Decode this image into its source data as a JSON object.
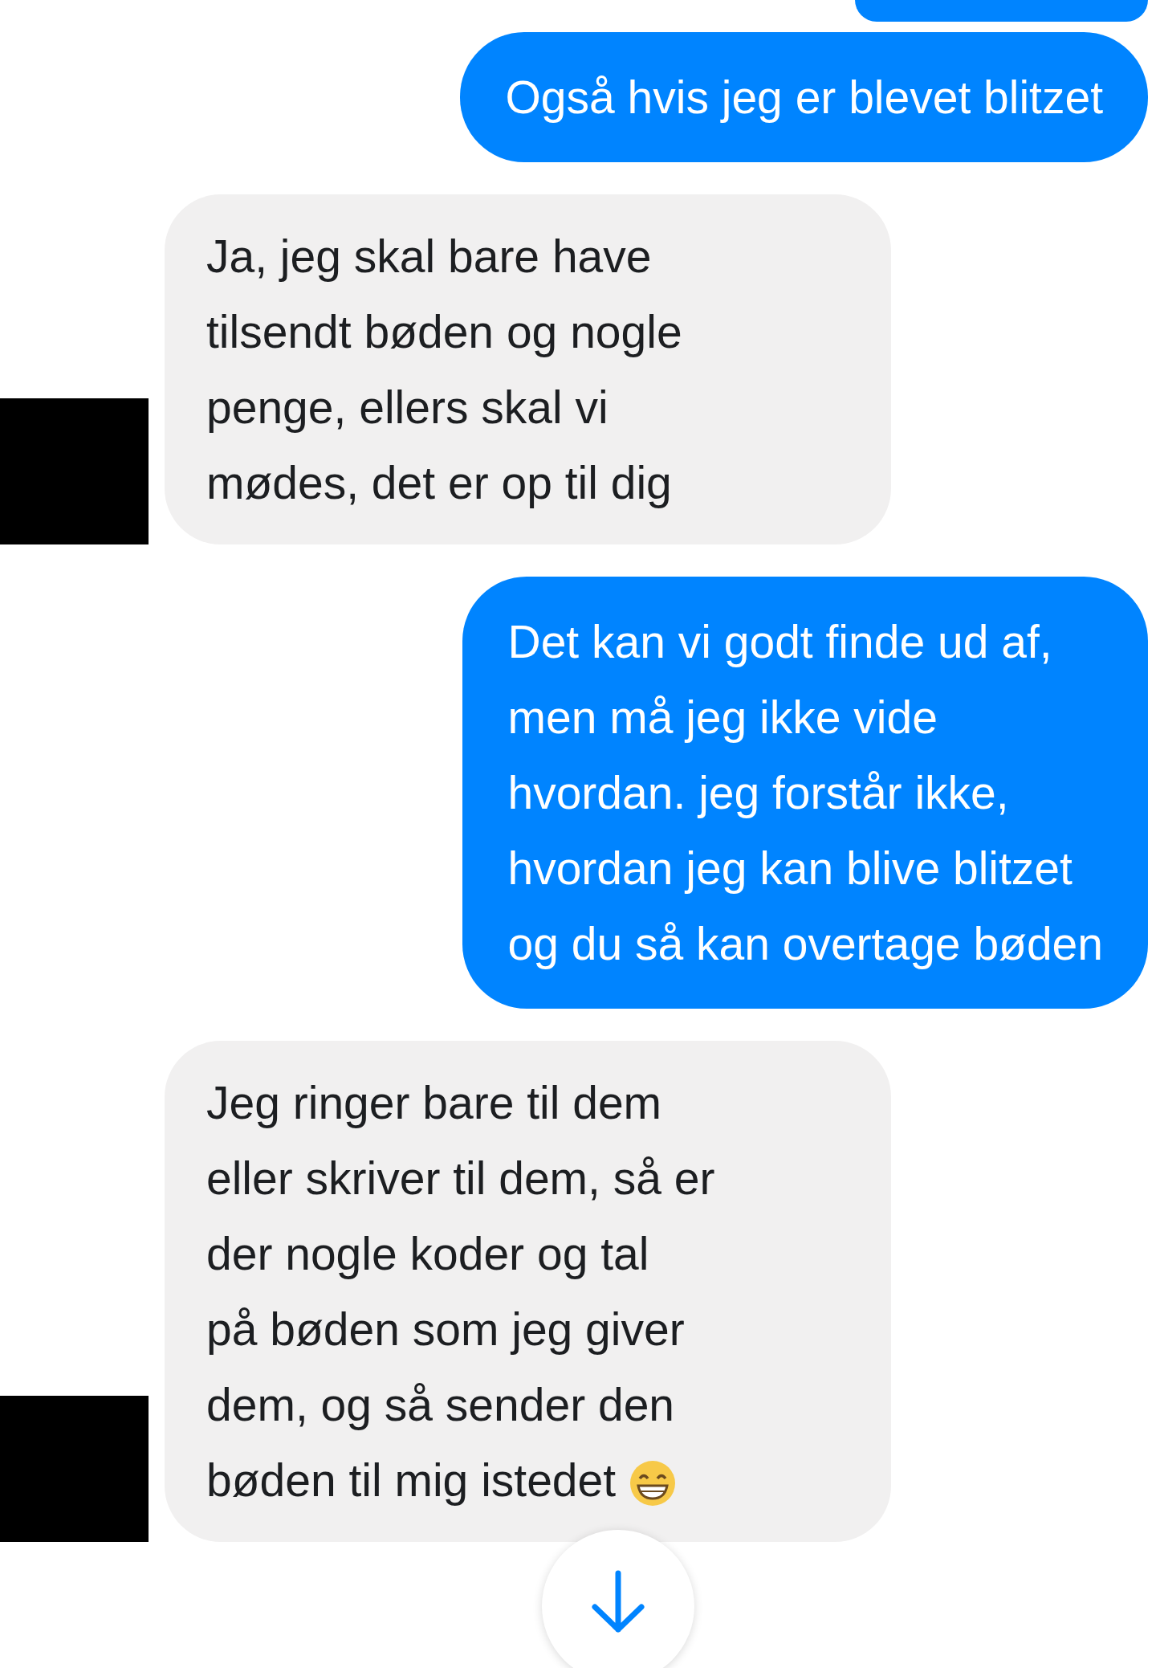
{
  "messages": [
    {
      "kind": "sent",
      "lines": [
        "Også hvis jeg er blevet blitzet"
      ],
      "emoji": false
    },
    {
      "kind": "received",
      "lines": [
        "Ja, jeg skal bare have",
        "tilsendt bøden og nogle",
        "penge, ellers skal vi",
        "mødes, det er op til dig"
      ],
      "emoji": false
    },
    {
      "kind": "sent",
      "lines": [
        "Det kan vi godt finde ud af,",
        "men må jeg ikke vide",
        "hvordan. jeg forstår ikke,",
        "hvordan jeg kan blive blitzet",
        "og du så kan overtage bøden"
      ],
      "emoji": false
    },
    {
      "kind": "received",
      "lines": [
        "Jeg ringer bare til dem",
        "eller skriver til dem, så er",
        "der nogle koder og tal",
        "på bøden som jeg giver",
        "dem, og så sender den",
        "bøden til mig istedet"
      ],
      "emoji": true
    }
  ]
}
